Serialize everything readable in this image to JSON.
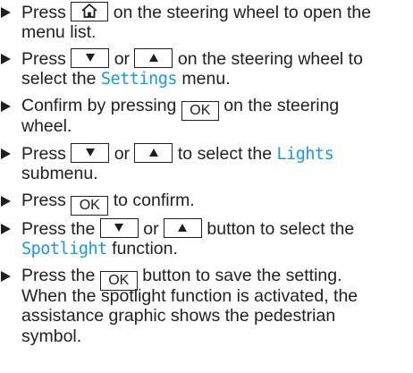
{
  "steps": [
    {
      "s1": "Press",
      "s2": "on the steering wheel to open the",
      "s3": "menu list."
    },
    {
      "s1": "Press",
      "s2": "or",
      "s3": "on the steering wheel to",
      "s4": "select the",
      "hl": "Settings",
      "s5": "menu."
    },
    {
      "s1": "Confirm by pressing",
      "s2": "on the steering",
      "s3": "wheel."
    },
    {
      "s1": "Press",
      "s2": "or",
      "s3": "to select the",
      "hl": "Lights",
      "s4": "submenu."
    },
    {
      "s1": "Press",
      "s2": "to confirm."
    },
    {
      "s1": "Press the",
      "s2": "or",
      "s3": "button to select the",
      "hl": "Spotlight",
      "s4": "function."
    },
    {
      "s1": "Press the",
      "s2": "button to save the setting.",
      "s3": "When the spotlight function is activated, the",
      "s4": "assistance graphic shows the pedestrian",
      "s5": "symbol."
    }
  ],
  "keys": {
    "ok": "OK",
    "home_icon": "home-icon",
    "down_icon": "down-arrow-icon",
    "up_icon": "up-arrow-icon"
  },
  "colors": {
    "text": "#1f1f1f",
    "highlight": "#1a9ad9"
  }
}
